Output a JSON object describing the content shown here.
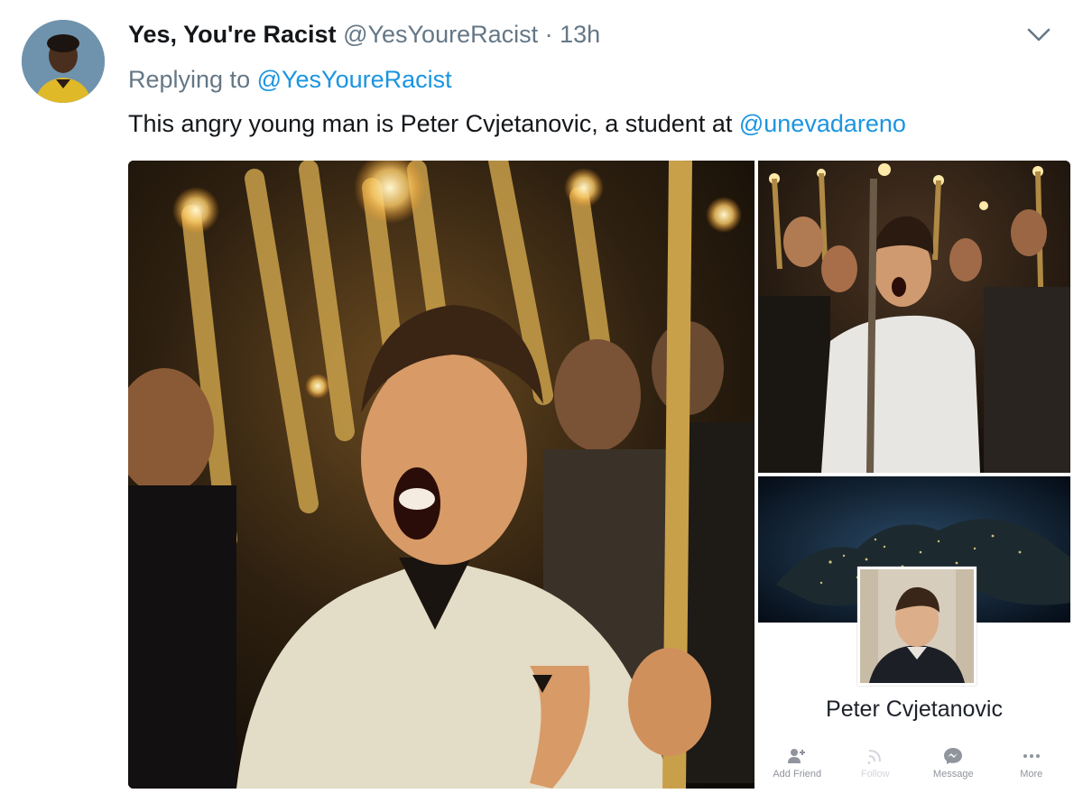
{
  "tweet": {
    "display_name": "Yes, You're Racist",
    "handle": "@YesYoureRacist",
    "separator": "·",
    "time": "13h",
    "replying_prefix": "Replying to ",
    "replying_handle": "@YesYoureRacist",
    "text": "This angry young man is Peter Cvjetanovic, a student at ",
    "text_mention": "@unevadareno"
  },
  "profile_card": {
    "name": "Peter Cvjetanovic",
    "actions": [
      {
        "label": "Add Friend",
        "icon": "add-friend-icon"
      },
      {
        "label": "Follow",
        "icon": "follow-icon",
        "disabled": true
      },
      {
        "label": "Message",
        "icon": "message-icon"
      },
      {
        "label": "More",
        "icon": "more-icon"
      }
    ]
  },
  "colors": {
    "link": "#1b95e0",
    "secondary_text": "#657786",
    "primary_text": "#14171a"
  }
}
